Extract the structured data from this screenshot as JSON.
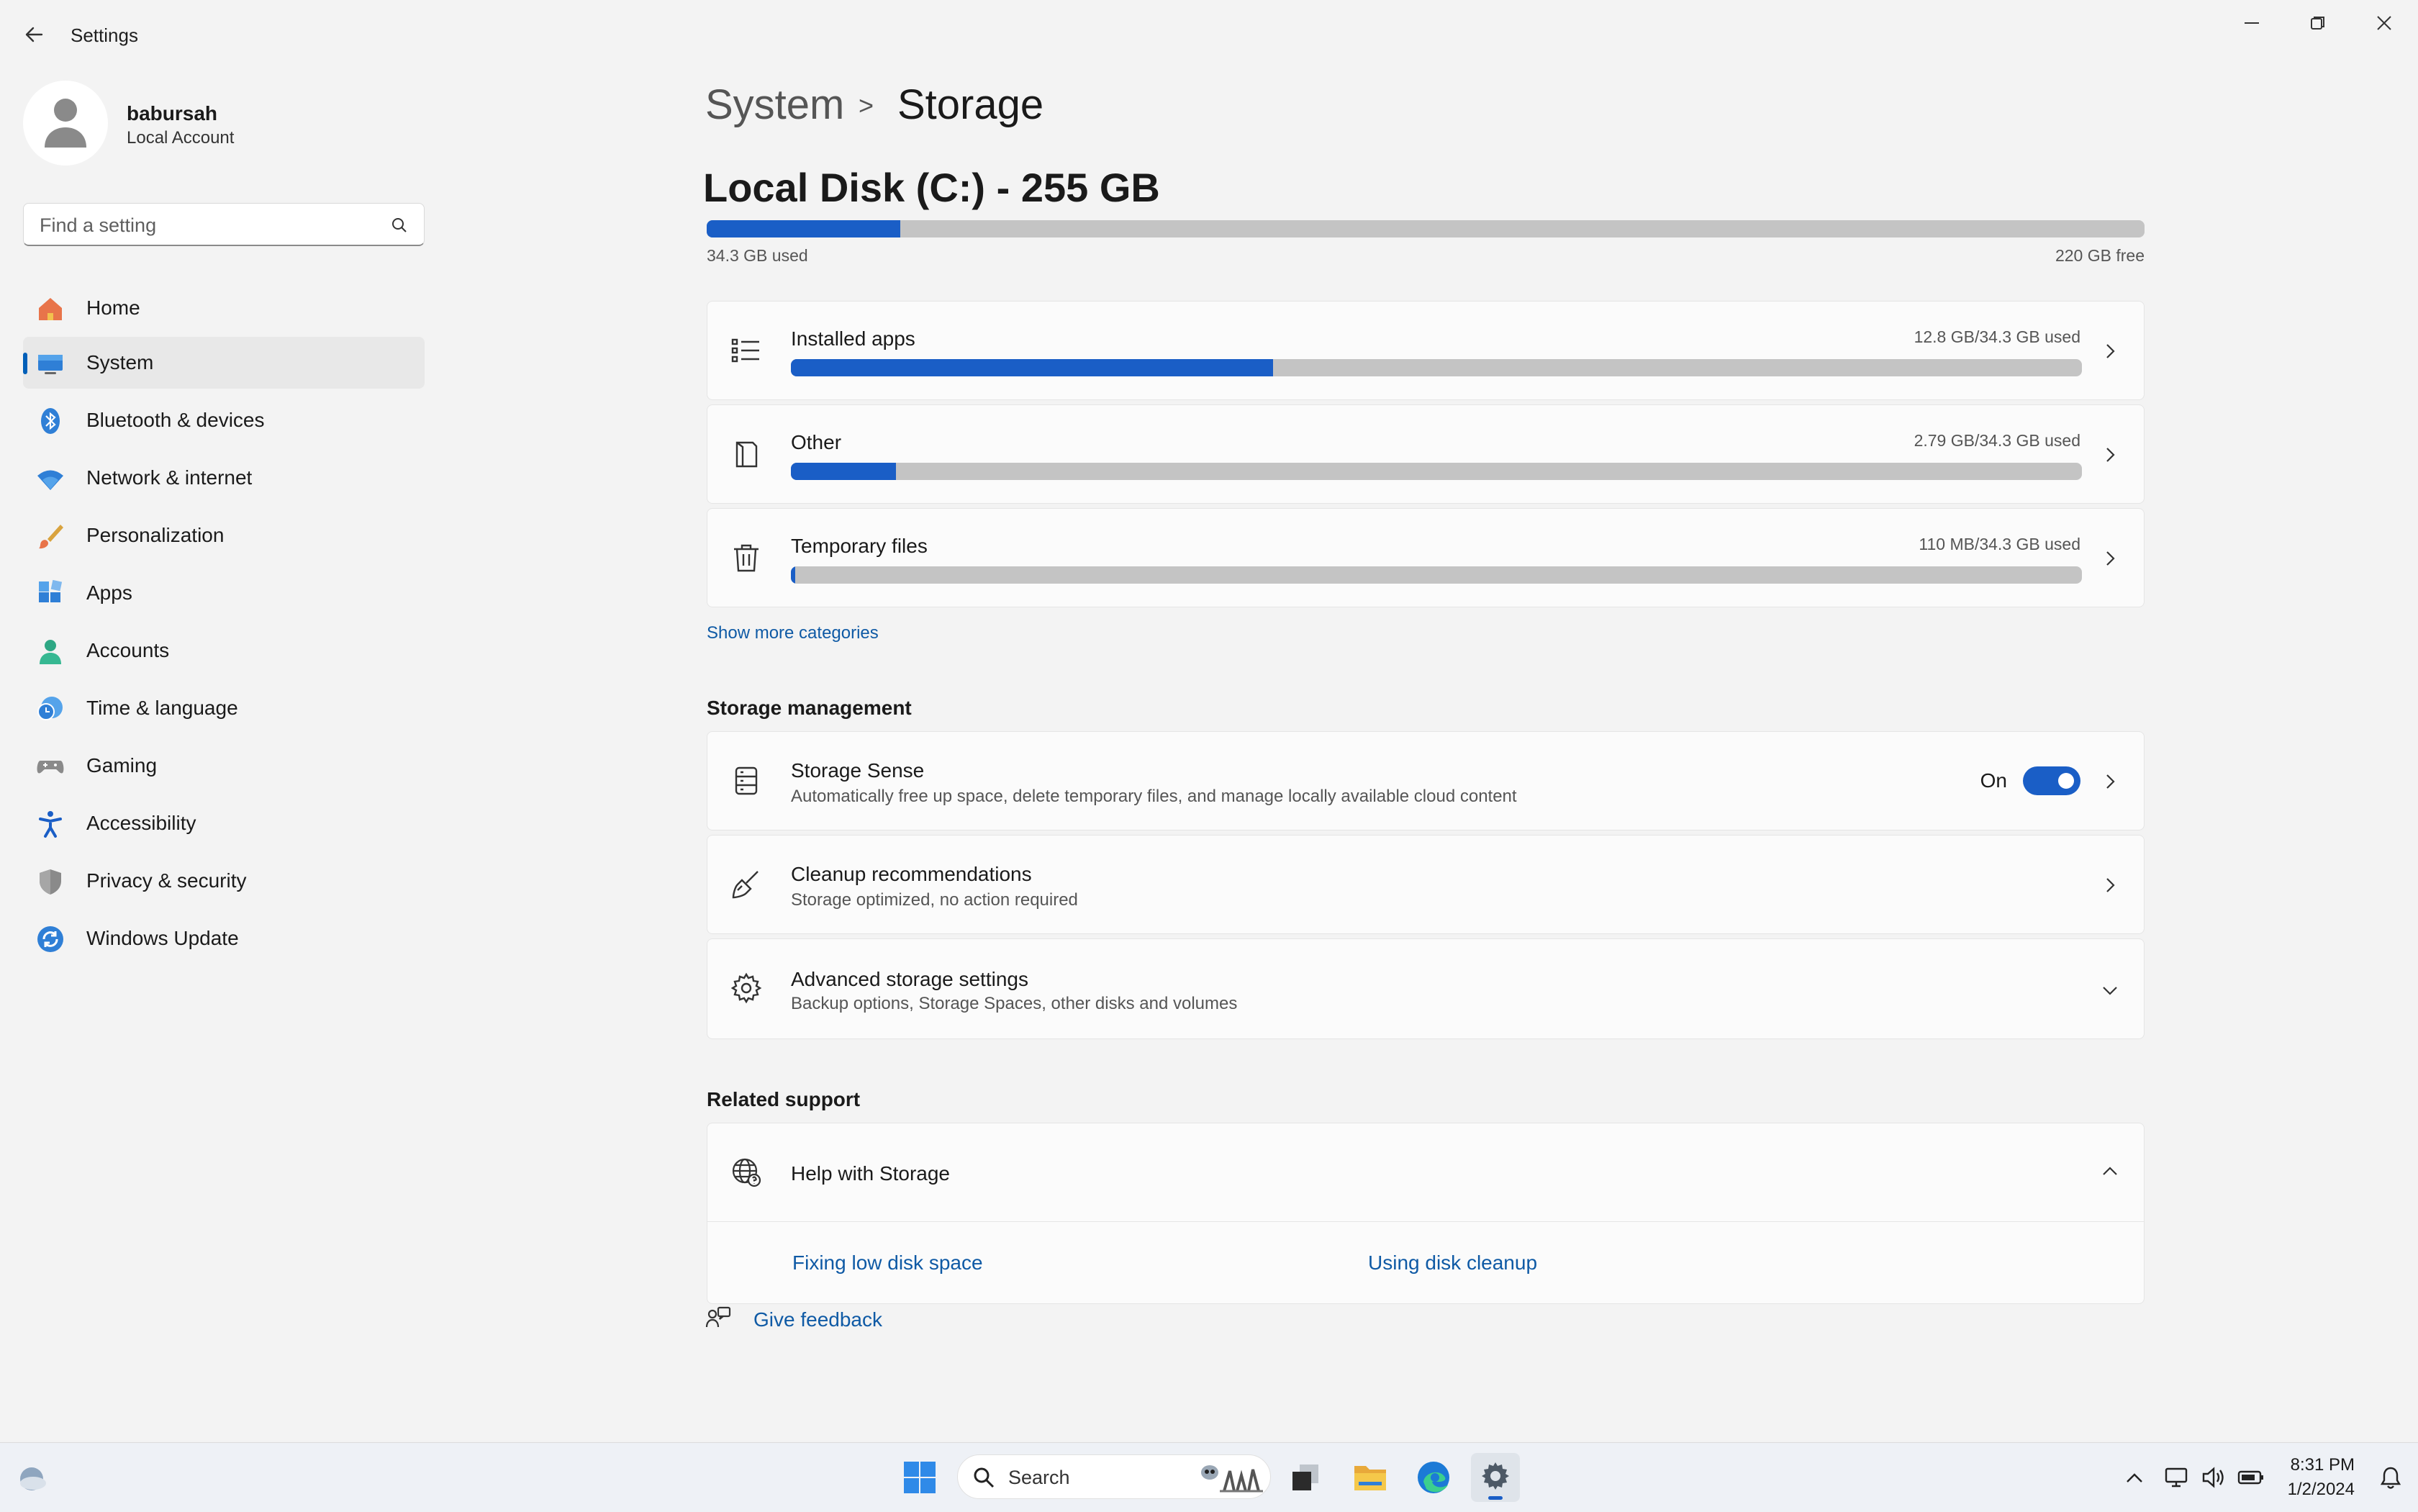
{
  "window": {
    "title": "Settings"
  },
  "profile": {
    "name": "babursah",
    "account_type": "Local Account"
  },
  "search": {
    "placeholder": "Find a setting"
  },
  "nav": [
    {
      "label": "Home",
      "icon": "home-icon"
    },
    {
      "label": "System",
      "icon": "system-icon",
      "active": true
    },
    {
      "label": "Bluetooth & devices",
      "icon": "bluetooth-icon"
    },
    {
      "label": "Network & internet",
      "icon": "wifi-icon"
    },
    {
      "label": "Personalization",
      "icon": "brush-icon"
    },
    {
      "label": "Apps",
      "icon": "apps-icon"
    },
    {
      "label": "Accounts",
      "icon": "accounts-icon"
    },
    {
      "label": "Time & language",
      "icon": "clock-globe-icon"
    },
    {
      "label": "Gaming",
      "icon": "gamepad-icon"
    },
    {
      "label": "Accessibility",
      "icon": "accessibility-icon"
    },
    {
      "label": "Privacy & security",
      "icon": "shield-icon"
    },
    {
      "label": "Windows Update",
      "icon": "update-icon"
    }
  ],
  "breadcrumb": {
    "parent": "System",
    "separator": ">",
    "current": "Storage"
  },
  "disk": {
    "title": "Local Disk (C:) - 255 GB",
    "used_label": "34.3 GB used",
    "free_label": "220 GB free",
    "used_fraction": 0.1345
  },
  "categories": [
    {
      "label": "Installed apps",
      "usage": "12.8 GB/34.3 GB used",
      "fraction": 0.3732,
      "icon": "list-icon"
    },
    {
      "label": "Other",
      "usage": "2.79 GB/34.3 GB used",
      "fraction": 0.0813,
      "icon": "document-icon"
    },
    {
      "label": "Temporary files",
      "usage": "110 MB/34.3 GB used",
      "fraction": 0.0032,
      "icon": "trash-icon"
    }
  ],
  "show_more": "Show more categories",
  "storage_management": {
    "heading": "Storage management",
    "storage_sense": {
      "title": "Storage Sense",
      "subtitle": "Automatically free up space, delete temporary files, and manage locally available cloud content",
      "state_label": "On"
    },
    "cleanup": {
      "title": "Cleanup recommendations",
      "subtitle": "Storage optimized, no action required"
    },
    "advanced": {
      "title": "Advanced storage settings",
      "subtitle": "Backup options, Storage Spaces, other disks and volumes"
    }
  },
  "related_support": {
    "heading": "Related support",
    "help_title": "Help with Storage",
    "links": [
      "Fixing low disk space",
      "Using disk cleanup"
    ]
  },
  "feedback": "Give feedback",
  "taskbar": {
    "search_label": "Search",
    "time": "8:31 PM",
    "date": "1/2/2024"
  },
  "colors": {
    "accent": "#1a5ec6",
    "track": "#c4c4c4",
    "link": "#0f5aa5"
  }
}
